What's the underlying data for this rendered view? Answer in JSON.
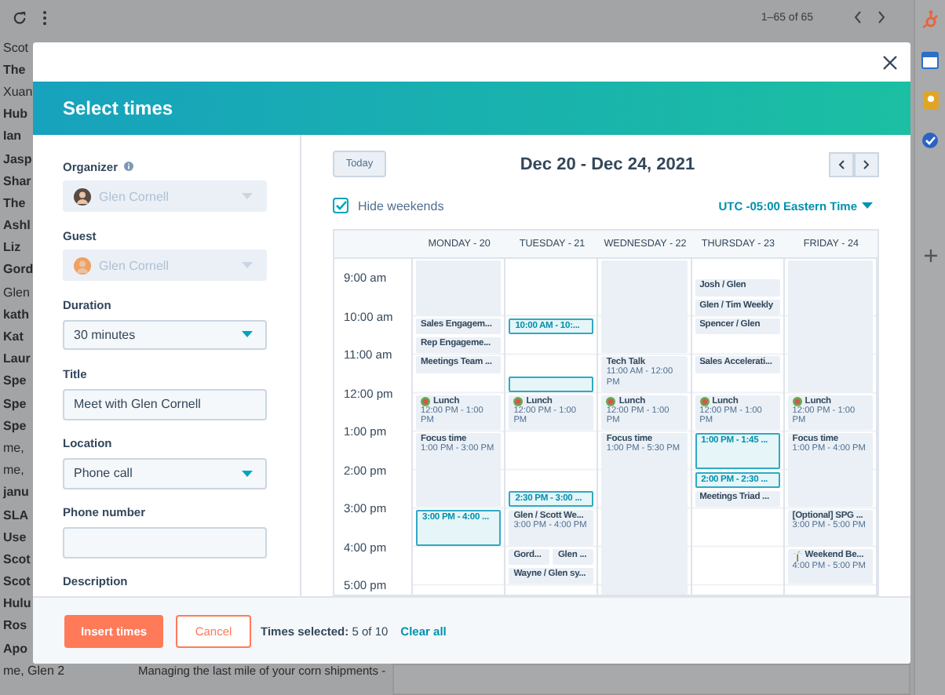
{
  "inbox": {
    "count": "1–65 of 65",
    "rows": [
      {
        "sender": "Scot",
        "unread": false
      },
      {
        "sender": "The",
        "unread": true
      },
      {
        "sender": "Xuan",
        "unread": false
      },
      {
        "sender": "Hub",
        "unread": true
      },
      {
        "sender": "Ian",
        "unread": true
      },
      {
        "sender": "Jasp",
        "unread": true
      },
      {
        "sender": "Shar",
        "unread": true
      },
      {
        "sender": "The",
        "unread": true
      },
      {
        "sender": "Ashl",
        "unread": true
      },
      {
        "sender": "Liz",
        "unread": true
      },
      {
        "sender": "Gord",
        "unread": true
      },
      {
        "sender": "Glen",
        "unread": false
      },
      {
        "sender": "kath",
        "unread": true
      },
      {
        "sender": "Kat",
        "unread": true
      },
      {
        "sender": "Laur",
        "unread": true
      },
      {
        "sender": "Spe",
        "unread": true
      },
      {
        "sender": "Spe",
        "unread": true
      },
      {
        "sender": "Spe",
        "unread": true
      },
      {
        "sender": "me,",
        "unread": false
      },
      {
        "sender": "me,",
        "unread": false
      },
      {
        "sender": "janu",
        "unread": true
      },
      {
        "sender": "SLA",
        "unread": true
      },
      {
        "sender": "Use",
        "unread": true
      },
      {
        "sender": "Scot",
        "unread": true
      },
      {
        "sender": "Scot",
        "unread": true
      },
      {
        "sender": "Hulu",
        "unread": true
      },
      {
        "sender": "Ros",
        "unread": true
      },
      {
        "sender": "Apo",
        "unread": true
      },
      {
        "sender": "me, Glen 2",
        "unread": false,
        "subject": "Managing the last mile of your corn shipments -"
      }
    ]
  },
  "modal": {
    "title": "Select times",
    "fields": [
      {
        "label": "Organizer",
        "kind": "select",
        "value": "Glen Cornell",
        "disabled": true,
        "avatar": true,
        "info": true
      },
      {
        "label": "Guest",
        "kind": "select",
        "value": "Glen Cornell",
        "disabled": true,
        "avatar": true
      },
      {
        "label": "Duration",
        "kind": "select",
        "value": "30 minutes",
        "disabled": false
      },
      {
        "label": "Title",
        "kind": "input",
        "value": "Meet with Glen Cornell",
        "disabled": false
      },
      {
        "label": "Location",
        "kind": "select",
        "value": "Phone call",
        "disabled": false
      },
      {
        "label": "Phone number",
        "kind": "input",
        "disabled": false
      },
      {
        "label": "Description",
        "kind": "label"
      }
    ],
    "calendar": {
      "today": "Today",
      "range": "Dec 20 - Dec 24, 2021",
      "hide_weekends": {
        "label": "Hide weekends",
        "checked": true
      },
      "timezone": "UTC -05:00 Eastern Time",
      "hours": [
        "9:00 am",
        "10:00 am",
        "11:00 am",
        "12:00 pm",
        "1:00 pm",
        "2:00 pm",
        "3:00 pm",
        "4:00 pm",
        "5:00 pm"
      ],
      "days": [
        {
          "label": "MONDAY - 20",
          "slots": [
            {
              "kind": "blocked"
            },
            {
              "kind": "continued"
            },
            {
              "kind": "continued"
            },
            {
              "kind": "event",
              "title": "Sales Engagem..."
            },
            {
              "kind": "event",
              "title": "Rep Engageme..."
            },
            {
              "kind": "event",
              "title": "Meetings Team ..."
            },
            {
              "kind": "free"
            },
            {
              "kind": "lunch",
              "title": "Lunch",
              "time": "12:00 PM - 1:00 PM"
            },
            {
              "kind": "continued"
            },
            {
              "kind": "event",
              "title": "Focus time",
              "time": "1:00 PM - 3:00 PM"
            },
            {
              "kind": "continued"
            },
            {
              "kind": "continued"
            },
            {
              "kind": "continued"
            },
            {
              "kind": "selected",
              "title": "3:00 PM - 4:00 ..."
            },
            {
              "kind": "continued"
            },
            {
              "kind": "free"
            },
            {
              "kind": "free"
            },
            {
              "kind": "free"
            }
          ]
        },
        {
          "label": "TUESDAY - 21",
          "slots": [
            {
              "kind": "free"
            },
            {
              "kind": "free"
            },
            {
              "kind": "free"
            },
            {
              "kind": "selected",
              "title": "10:00 AM - 10:..."
            },
            {
              "kind": "free"
            },
            {
              "kind": "free"
            },
            {
              "kind": "selected"
            },
            {
              "kind": "lunch",
              "title": "Lunch",
              "time": "12:00 PM - 1:00 PM"
            },
            {
              "kind": "continued"
            },
            {
              "kind": "free"
            },
            {
              "kind": "free"
            },
            {
              "kind": "free"
            },
            {
              "kind": "selected",
              "title": "2:30 PM - 3:00 ..."
            },
            {
              "kind": "event",
              "title": "Glen / Scott We...",
              "time": "3:00 PM - 4:00 PM"
            },
            {
              "kind": "continued"
            },
            {
              "kind": "pair",
              "titles": [
                "Gord...",
                "Glen ..."
              ]
            },
            {
              "kind": "event",
              "title": "Wayne / Glen sy..."
            },
            {
              "kind": "free"
            }
          ]
        },
        {
          "label": "WEDNESDAY - 22",
          "slots": [
            {
              "kind": "blocked"
            },
            {
              "kind": "continued"
            },
            {
              "kind": "continued"
            },
            {
              "kind": "continued"
            },
            {
              "kind": "continued"
            },
            {
              "kind": "event",
              "title": "Tech Talk",
              "time": "11:00 AM - 12:00 PM"
            },
            {
              "kind": "continued"
            },
            {
              "kind": "lunch",
              "title": "Lunch",
              "time": "12:00 PM - 1:00 PM"
            },
            {
              "kind": "continued"
            },
            {
              "kind": "event",
              "title": "Focus time",
              "time": "1:00 PM - 5:30 PM"
            },
            {
              "kind": "continued"
            },
            {
              "kind": "continued"
            },
            {
              "kind": "continued"
            },
            {
              "kind": "continued"
            },
            {
              "kind": "continued"
            },
            {
              "kind": "continued"
            },
            {
              "kind": "continued"
            },
            {
              "kind": "continued"
            }
          ]
        },
        {
          "label": "THURSDAY - 23",
          "slots": [
            {
              "kind": "free"
            },
            {
              "kind": "event",
              "title": "Josh / Glen"
            },
            {
              "kind": "event",
              "title": "Glen / Tim Weekly"
            },
            {
              "kind": "event",
              "title": "Spencer / Glen"
            },
            {
              "kind": "free"
            },
            {
              "kind": "event",
              "title": "Sales Accelerati..."
            },
            {
              "kind": "free"
            },
            {
              "kind": "lunch",
              "title": "Lunch",
              "time": "12:00 PM - 1:00 PM"
            },
            {
              "kind": "continued"
            },
            {
              "kind": "selected",
              "title": "1:00 PM - 1:45 ..."
            },
            {
              "kind": "continued"
            },
            {
              "kind": "selected",
              "title": "2:00 PM - 2:30 ..."
            },
            {
              "kind": "event",
              "title": "Meetings Triad ..."
            },
            {
              "kind": "free"
            },
            {
              "kind": "free"
            },
            {
              "kind": "free"
            },
            {
              "kind": "free"
            },
            {
              "kind": "free"
            }
          ]
        },
        {
          "label": "FRIDAY - 24",
          "slots": [
            {
              "kind": "blocked"
            },
            {
              "kind": "continued"
            },
            {
              "kind": "continued"
            },
            {
              "kind": "continued"
            },
            {
              "kind": "continued"
            },
            {
              "kind": "continued"
            },
            {
              "kind": "continued"
            },
            {
              "kind": "lunch",
              "title": "Lunch",
              "time": "12:00 PM - 1:00 PM"
            },
            {
              "kind": "continued"
            },
            {
              "kind": "event",
              "title": "Focus time",
              "time": "1:00 PM - 4:00 PM"
            },
            {
              "kind": "continued"
            },
            {
              "kind": "continued"
            },
            {
              "kind": "continued"
            },
            {
              "kind": "event",
              "title": "[Optional] SPG ...",
              "time": "3:00 PM - 5:00 PM"
            },
            {
              "kind": "continued"
            },
            {
              "kind": "holiday",
              "title": "Weekend Be...",
              "time": "4:00 PM - 5:00 PM"
            },
            {
              "kind": "continued"
            },
            {
              "kind": "free"
            }
          ]
        }
      ]
    },
    "footer": {
      "primary": "Insert times",
      "secondary": "Cancel",
      "summary": "**Times selected:** 5 of 10",
      "clear": "Clear all"
    }
  }
}
